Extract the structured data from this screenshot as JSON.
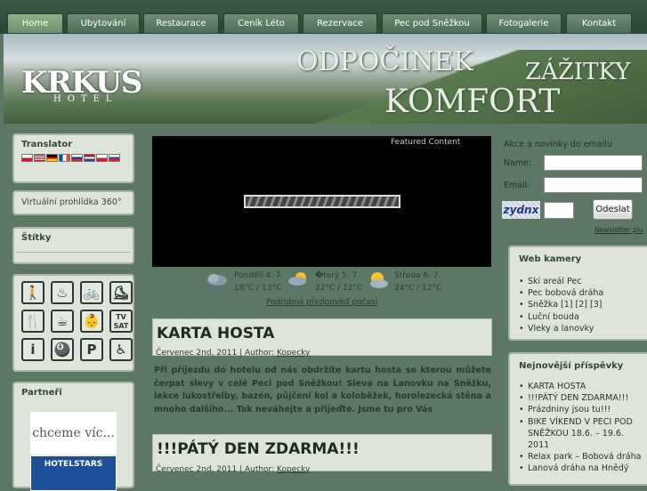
{
  "nav": [
    "Home",
    "Ubytování",
    "Restaurace",
    "Ceník Léto",
    "Rezervace",
    "Pec pod Sněžkou",
    "Fotogalerie",
    "Kontakt"
  ],
  "header": {
    "logo": "KRKUS",
    "logo_sub": "HOTEL",
    "slogan1": "ODPOČINEK",
    "slogan2": "ZÁŽITKY",
    "slogan3": "KOMFORT"
  },
  "left": {
    "translator_title": "Translator",
    "flags": [
      "cz",
      "us",
      "de",
      "fr",
      "ru",
      "nl",
      "pl",
      "sk"
    ],
    "tour": "Virtuální prohlídka 360°",
    "tags_title": "Štítky",
    "partners_title": "Partneři",
    "partner1": "chceme víc...",
    "partner2": "HOTELSTARS",
    "icons": [
      "person-icon",
      "wellness-icon",
      "bike-icon",
      "skating-icon",
      "restaurant-icon",
      "bar-icon",
      "kids-icon",
      "tv-sat-icon",
      "info-icon",
      "billiards-icon",
      "parking-icon",
      "wheelchair-icon"
    ],
    "icon_glyphs": [
      "🚶",
      "♨",
      "🚲",
      "⛸",
      "🍴",
      "☕",
      "👶",
      "TV SAT",
      "i",
      "🎱",
      "P",
      "♿"
    ]
  },
  "center": {
    "featured_label": "Featured Content",
    "weather": [
      {
        "day": "Pondělí 4. 7.",
        "temp": "18°C / 13°C"
      },
      {
        "day": "�terý 5. 7.",
        "temp": "22°C / 12°C"
      },
      {
        "day": "Středa 6. 7.",
        "temp": "24°C / 12°C"
      }
    ],
    "forecast_link": "Podrobná předpověď počasí",
    "articles": [
      {
        "title": "KARTA HOSTA",
        "date": "Červenec 2nd, 2011 | Author: ",
        "author": "Kopecky",
        "excerpt": "Při příjezdu do hotelu od nás obdržíte kartu hosta se kterou můžete čerpat slevy v celé Peci pod Sněžkou! Sleva na Lanovku na Sněžku, lekce lukostřelby, bazén, půjčení kol a koloběžek, horolezecká stěna a mnoho dalšího... Tak neváhejte a přijeďte. Jsme tu pro Vás"
      },
      {
        "title": "!!!PÁTÝ DEN ZDARMA!!!",
        "date": "Červenec 2nd, 2011 | Author: ",
        "author": "Kopecky"
      }
    ]
  },
  "right": {
    "newsletter_title": "Akce a novinky do emailu",
    "name_label": "Name:",
    "email_label": "Email:",
    "captcha": "zydnx",
    "send": "Odeslat",
    "plugin": "Newsletter plu",
    "webcam_title": "Web kamery",
    "webcams": [
      "Ski areál Pec",
      "Pec bobová dráha",
      "Sněžka [1] [2] [3]",
      "Luční bouda",
      "Vleky a lanovky"
    ],
    "news_title": "Nejnovější příspěvky",
    "news": [
      "KARTA HOSTA",
      "!!!PÁTÝ DEN ZDARMA!!!",
      "Prázdniny jsou tu!!!",
      "BIKE VÍKEND V PECI POD SNĚŽKOU 18.6. – 19.6. 2011",
      "Relax park – Bobová dráha",
      "Lanová dráha na Hnědý"
    ]
  }
}
